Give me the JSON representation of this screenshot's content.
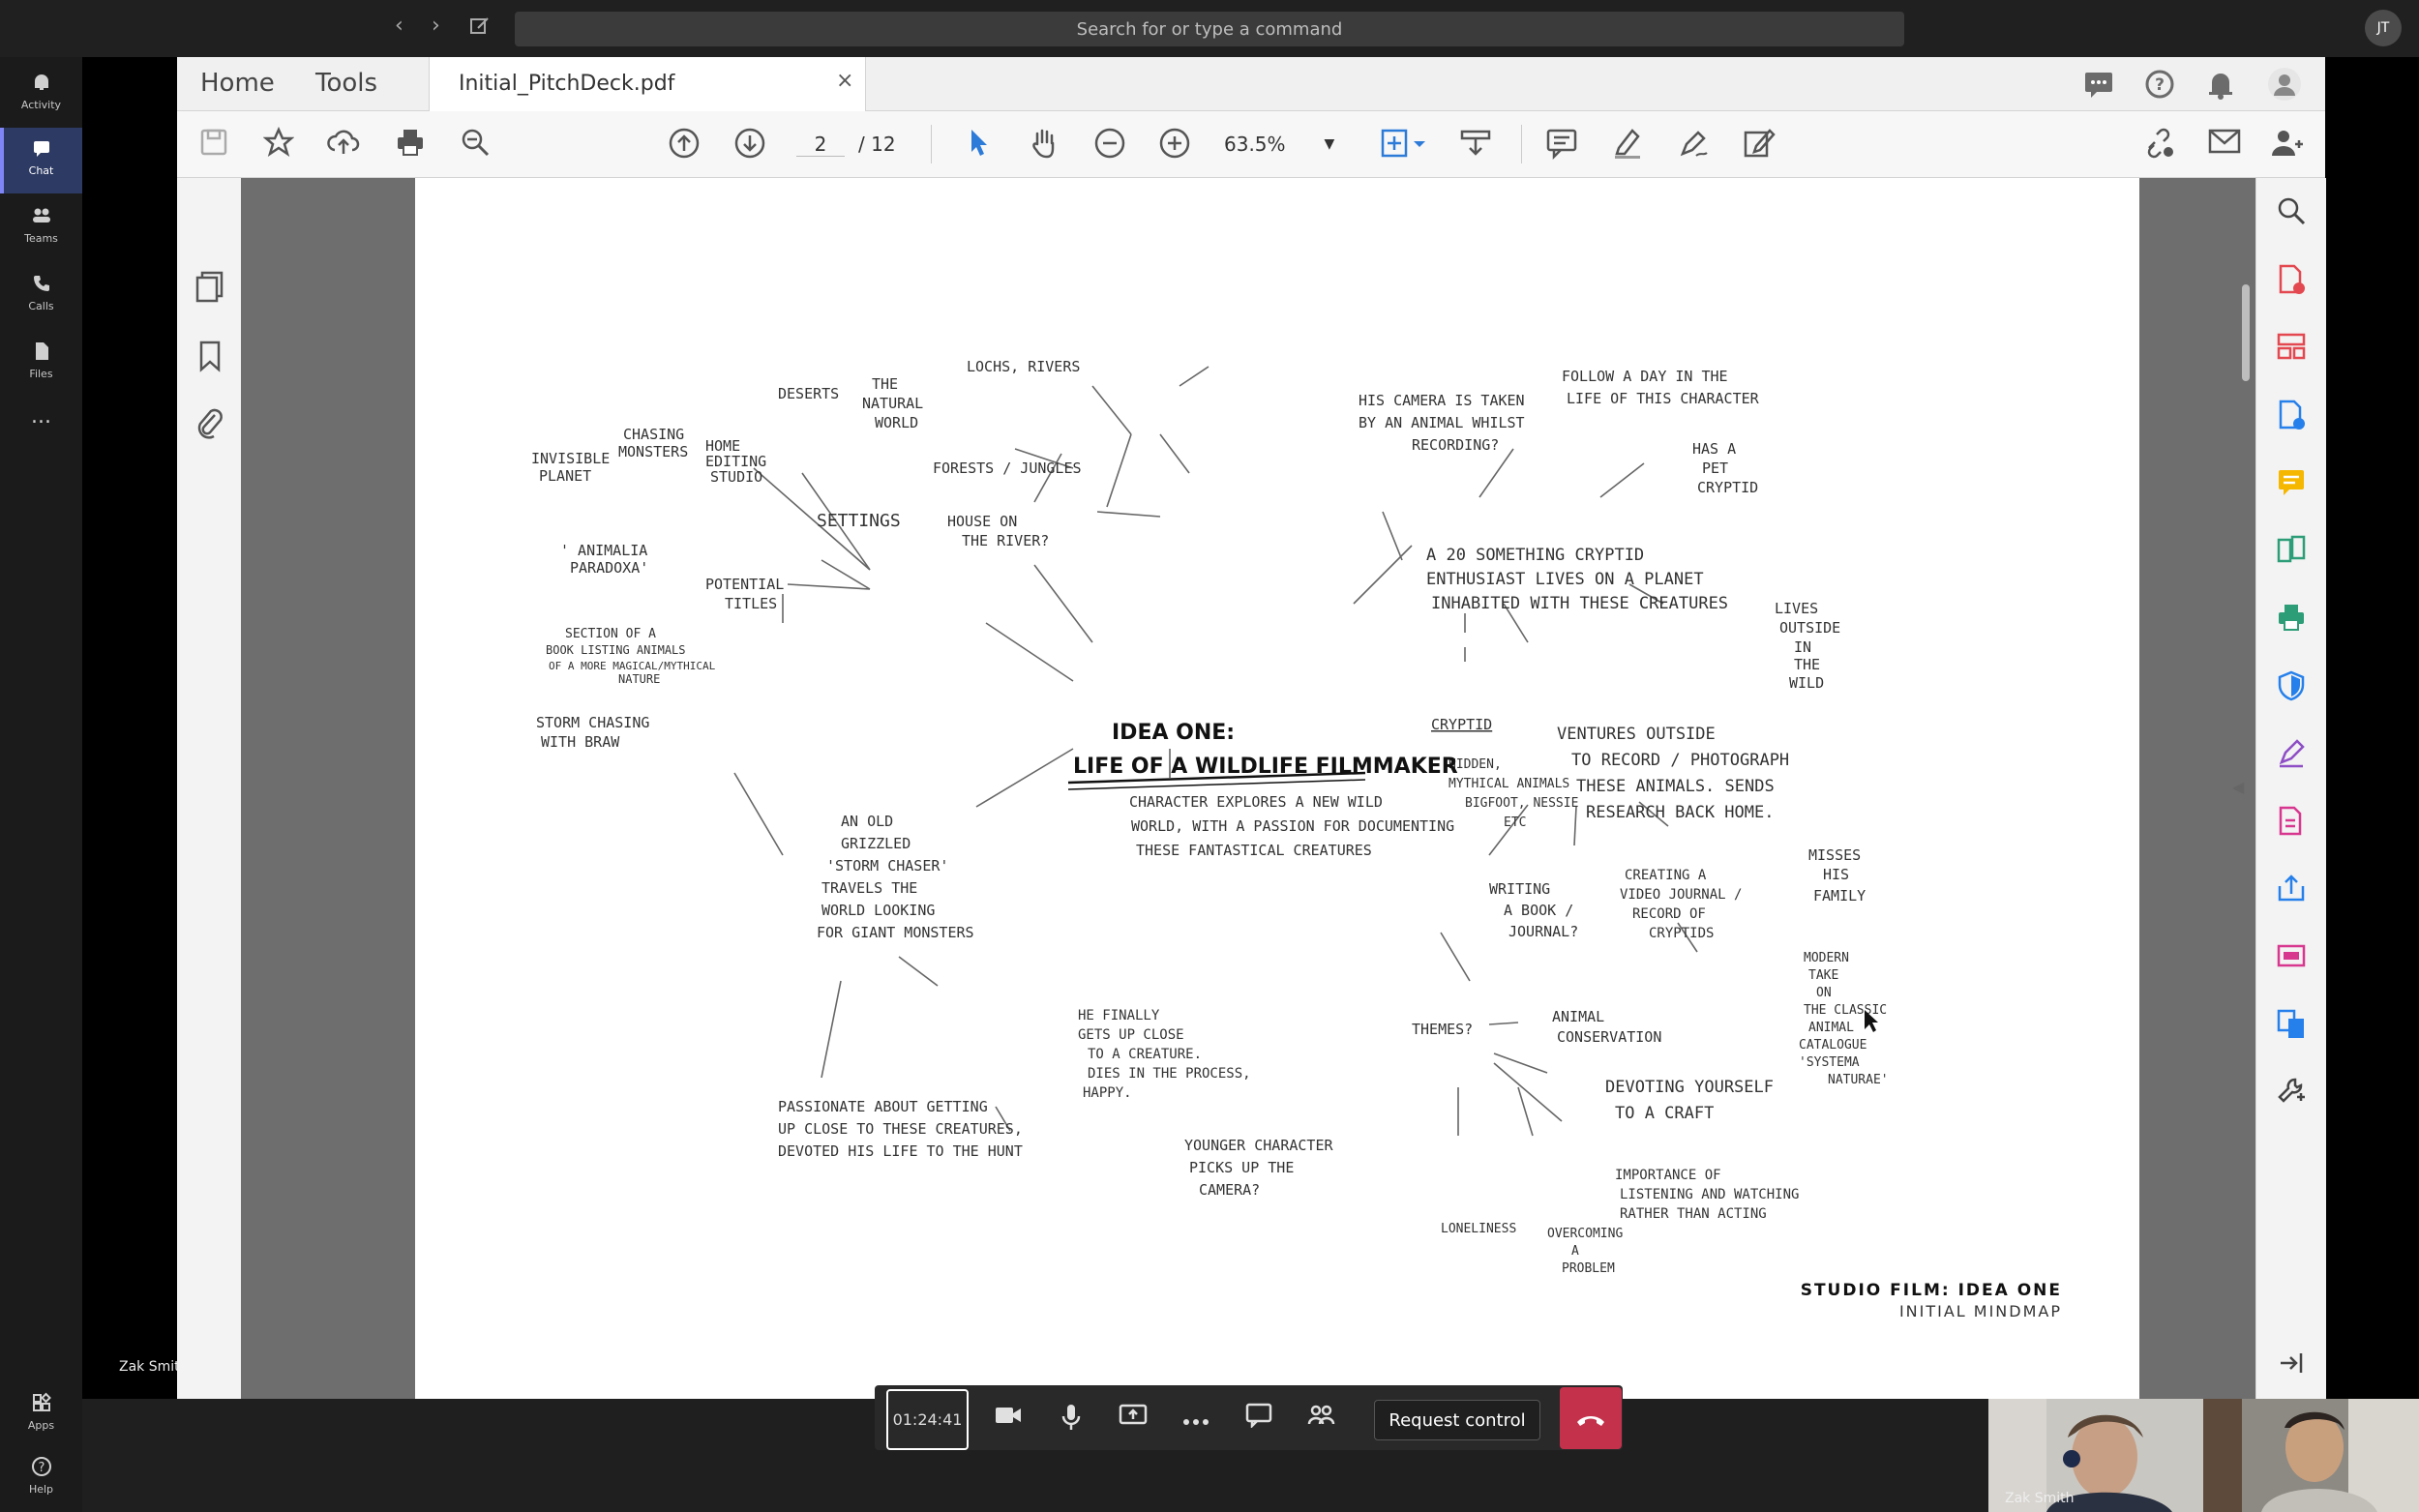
{
  "topbar": {
    "back": "‹",
    "forward": "›",
    "search_placeholder": "Search for or type a command",
    "user_initials": "JT"
  },
  "rail": {
    "items": [
      {
        "label": "Activity",
        "icon": "bell-icon"
      },
      {
        "label": "Chat",
        "icon": "chat-icon"
      },
      {
        "label": "Teams",
        "icon": "teams-icon"
      },
      {
        "label": "Calls",
        "icon": "phone-icon"
      },
      {
        "label": "Files",
        "icon": "file-icon"
      },
      {
        "label": "...",
        "icon": "more-icon"
      },
      {
        "label": "Apps",
        "icon": "apps-icon"
      },
      {
        "label": "Help",
        "icon": "help-icon"
      }
    ],
    "presenter_name": "Zak Smith"
  },
  "acrobat": {
    "tabs": {
      "home": "Home",
      "tools": "Tools",
      "document": "Initial_PitchDeck.pdf",
      "close": "×"
    },
    "page_current": "2",
    "page_total": "/ 12",
    "zoom": "63.5%"
  },
  "mindmap": {
    "center_line1": "IDEA ONE:",
    "center_line2": "LIFE OF A WILDLIFE FILMMAKER",
    "nodes": {
      "deserts": "DESERTS",
      "natural_world_1": "THE",
      "natural_world_2": "NATURAL",
      "natural_world_3": "WORLD",
      "lochs": "LOCHS, RIVERS",
      "forests": "FORESTS / JUNGLES",
      "home_edit_1": "HOME",
      "home_edit_2": "EDITING",
      "home_edit_3": "STUDIO",
      "settings": "SETTINGS",
      "house_1": "HOUSE ON",
      "house_2": "THE RIVER?",
      "invisible_1": "INVISIBLE",
      "invisible_2": "PLANET",
      "chasing_1": "CHASING",
      "chasing_2": "MONSTERS",
      "animalia_1": "' ANIMALIA",
      "animalia_2": "PARADOXA'",
      "potential_1": "POTENTIAL",
      "potential_2": "TITLES",
      "section_1": "SECTION OF A",
      "section_2": "BOOK LISTING ANIMALS",
      "section_3": "OF A MORE MAGICAL/MYTHICAL",
      "section_4": "NATURE",
      "storm_1": "STORM CHASING",
      "storm_2": "WITH BRAW",
      "old_1": "AN OLD",
      "old_2": "GRIZZLED",
      "old_3": "'STORM CHASER'",
      "old_4": "TRAVELS THE",
      "old_5": "WORLD LOOKING",
      "old_6": "FOR GIANT MONSTERS",
      "passionate_1": "PASSIONATE ABOUT GETTING",
      "passionate_2": "UP CLOSE TO THESE CREATURES,",
      "passionate_3": "DEVOTED HIS LIFE TO THE HUNT",
      "finally_1": "HE FINALLY",
      "finally_2": "GETS UP CLOSE",
      "finally_3": "TO A CREATURE.",
      "finally_4": "DIES IN THE PROCESS,",
      "finally_5": "HAPPY.",
      "younger_1": "YOUNGER CHARACTER",
      "younger_2": "PICKS UP THE",
      "younger_3": "CAMERA?",
      "character_1": "CHARACTER EXPLORES A NEW WILD",
      "character_2": "WORLD, WITH A PASSION FOR DOCUMENTING",
      "character_3": "THESE FANTASTICAL CREATURES",
      "camera_1": "HIS CAMERA IS TAKEN",
      "camera_2": "BY AN ANIMAL WHILST",
      "camera_3": "RECORDING?",
      "follow_1": "FOLLOW A DAY IN THE",
      "follow_2": "LIFE OF THIS CHARACTER",
      "pet_1": "HAS A",
      "pet_2": "PET",
      "pet_3": "CRYPTID",
      "enthusiast_1": "A 20 SOMETHING CRYPTID",
      "enthusiast_2": "ENTHUSIAST LIVES ON A PLANET",
      "enthusiast_3": "INHABITED WITH THESE CREATURES",
      "lives_1": "LIVES",
      "lives_2": "OUTSIDE",
      "lives_3": "IN",
      "lives_4": "THE",
      "lives_5": "WILD",
      "cryptid": "CRYPTID",
      "hidden_1": "HIDDEN,",
      "hidden_2": "MYTHICAL ANIMALS",
      "hidden_3": "BIGFOOT, NESSIE",
      "hidden_4": "ETC",
      "ventures_1": "VENTURES OUTSIDE",
      "ventures_2": "TO RECORD / PHOTOGRAPH",
      "ventures_3": "THESE ANIMALS. SENDS",
      "ventures_4": "RESEARCH BACK HOME.",
      "misses_1": "MISSES",
      "misses_2": "HIS",
      "misses_3": "FAMILY",
      "writing_1": "WRITING",
      "writing_2": "A BOOK /",
      "writing_3": "JOURNAL?",
      "creating_1": "CREATING A",
      "creating_2": "VIDEO JOURNAL /",
      "creating_3": "RECORD OF",
      "creating_4": "CRYPTIDS",
      "modern_1": "MODERN",
      "modern_2": "TAKE",
      "modern_3": "ON",
      "modern_4": "THE CLASSIC",
      "modern_5": "ANIMAL",
      "modern_6": "CATALOGUE",
      "modern_7": "'SYSTEMA",
      "modern_8": "NATURAE'",
      "themes": "THEMES?",
      "conservation_1": "ANIMAL",
      "conservation_2": "CONSERVATION",
      "devoting_1": "DEVOTING YOURSELF",
      "devoting_2": "TO A CRAFT",
      "listening_1": "IMPORTANCE OF",
      "listening_2": "LISTENING AND WATCHING",
      "listening_3": "RATHER THAN ACTING",
      "loneliness": "LONELINESS",
      "overcoming_1": "OVERCOMING",
      "overcoming_2": "A",
      "overcoming_3": "PROBLEM"
    },
    "footer_title": "STUDIO FILM: IDEA ONE",
    "footer_subtitle": "INITIAL MINDMAP"
  },
  "call": {
    "timer": "01:24:41",
    "request_control": "Request control",
    "participant_2_name": "Zak Smith"
  }
}
